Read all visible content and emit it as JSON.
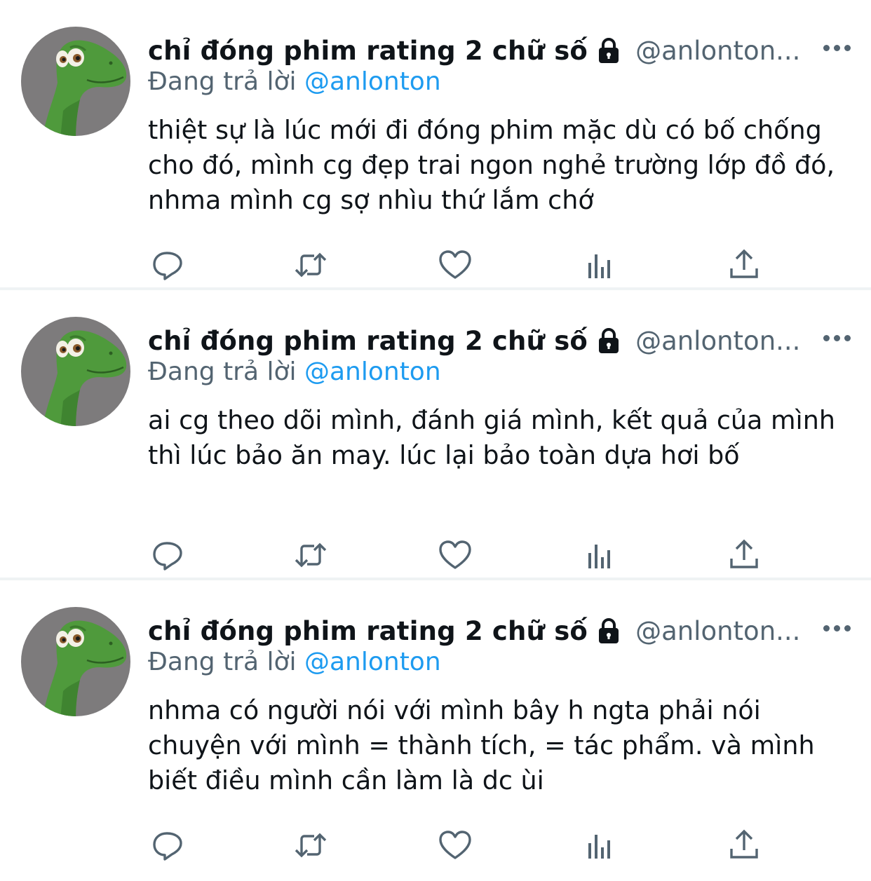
{
  "tweets": [
    {
      "display_name": "chỉ đóng phim rating 2 chữ số",
      "handle": "@anlonton...",
      "reply_prefix": "Đang trả lời ",
      "reply_to": "@anlonton",
      "text": "thiệt sự là lúc mới đi đóng phim mặc dù có bố chống cho đó, mình cg đẹp trai ngon nghẻ trường lớp đồ đó, nhma mình cg sợ nhìu thứ lắm chớ"
    },
    {
      "display_name": "chỉ đóng phim rating 2 chữ số",
      "handle": "@anlonton...",
      "reply_prefix": "Đang trả lời ",
      "reply_to": "@anlonton",
      "text": "ai cg theo dõi mình, đánh giá mình, kết quả của mình thì lúc bảo ăn may. lúc lại bảo toàn dựa hơi bố"
    },
    {
      "display_name": "chỉ đóng phim rating 2 chữ số",
      "handle": "@anlonton...",
      "reply_prefix": "Đang trả lời ",
      "reply_to": "@anlonton",
      "text": "nhma có người nói với mình bây h ngta phải nói chuyện với mình = thành tích, = tác phẩm. và mình biết điều mình cần làm là dc ùi"
    }
  ],
  "icons": {
    "avatar": "green-dinosaur-avatar",
    "protected": "lock-icon",
    "more": "more-dots-icon",
    "reply": "reply-icon",
    "retweet": "retweet-icon",
    "like": "heart-icon",
    "views": "analytics-icon",
    "share": "share-icon"
  },
  "colors": {
    "link": "#1d9bf0",
    "secondary_text": "#536471",
    "primary_text": "#0f1419",
    "divider": "#eff3f4"
  }
}
